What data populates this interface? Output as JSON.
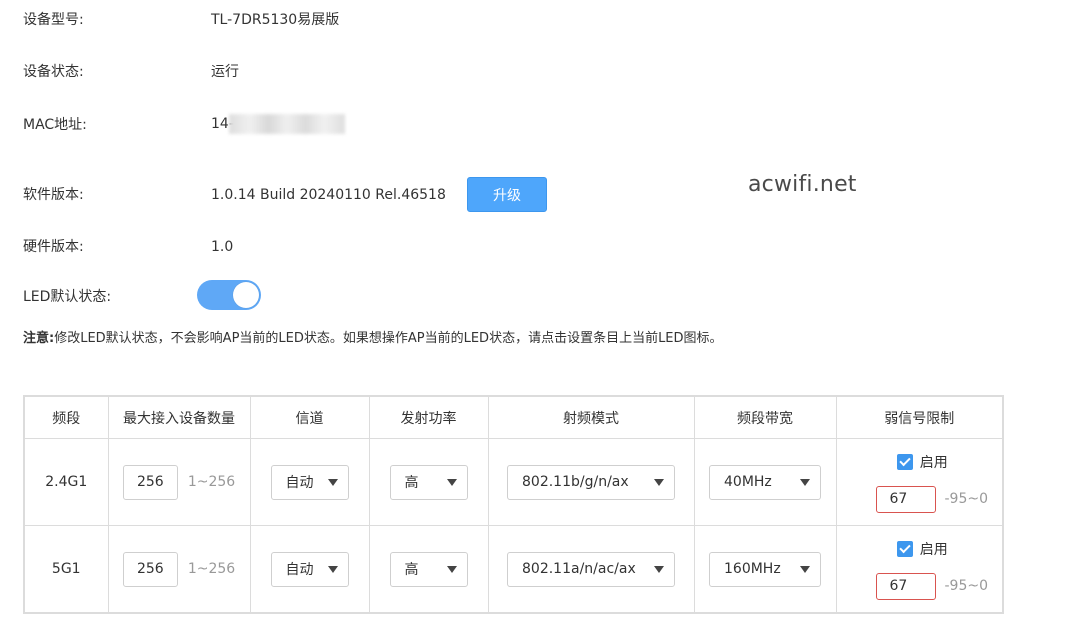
{
  "device": {
    "model_label": "设备型号:",
    "model_value": "TL-7DR5130易展版",
    "status_label": "设备状态:",
    "status_value": "运行",
    "mac_label": "MAC地址:",
    "mac_value": "14-",
    "software_label": "软件版本:",
    "software_value": "1.0.14 Build 20240110 Rel.46518",
    "upgrade_label": "升级",
    "hardware_label": "硬件版本:",
    "hardware_value": "1.0",
    "led_label": "LED默认状态:",
    "led_on": true
  },
  "note": {
    "prefix": "注意:",
    "text": "修改LED默认状态，不会影响AP当前的LED状态。如果想操作AP当前的LED状态，请点击设置条目上当前LED图标。"
  },
  "watermark": "acwifi.net",
  "table": {
    "headers": [
      "频段",
      "最大接入设备数量",
      "信道",
      "发射功率",
      "射频模式",
      "频段带宽",
      "弱信号限制"
    ],
    "rows": [
      {
        "band": "2.4G1",
        "max_devices": "256",
        "max_range": "1~256",
        "channel": "自动",
        "power": "高",
        "mode": "802.11b/g/n/ax",
        "bandwidth": "40MHz",
        "weak_enabled_label": "启用",
        "weak_value": "67",
        "weak_range": "-95~0"
      },
      {
        "band": "5G1",
        "max_devices": "256",
        "max_range": "1~256",
        "channel": "自动",
        "power": "高",
        "mode": "802.11a/n/ac/ax",
        "bandwidth": "160MHz",
        "weak_enabled_label": "启用",
        "weak_value": "67",
        "weak_range": "-95~0"
      }
    ]
  },
  "colors": {
    "accent": "#4ea6fb",
    "toggle": "#5fa8f6",
    "checkbox": "#3d97ee",
    "error_border": "#d9534f"
  }
}
